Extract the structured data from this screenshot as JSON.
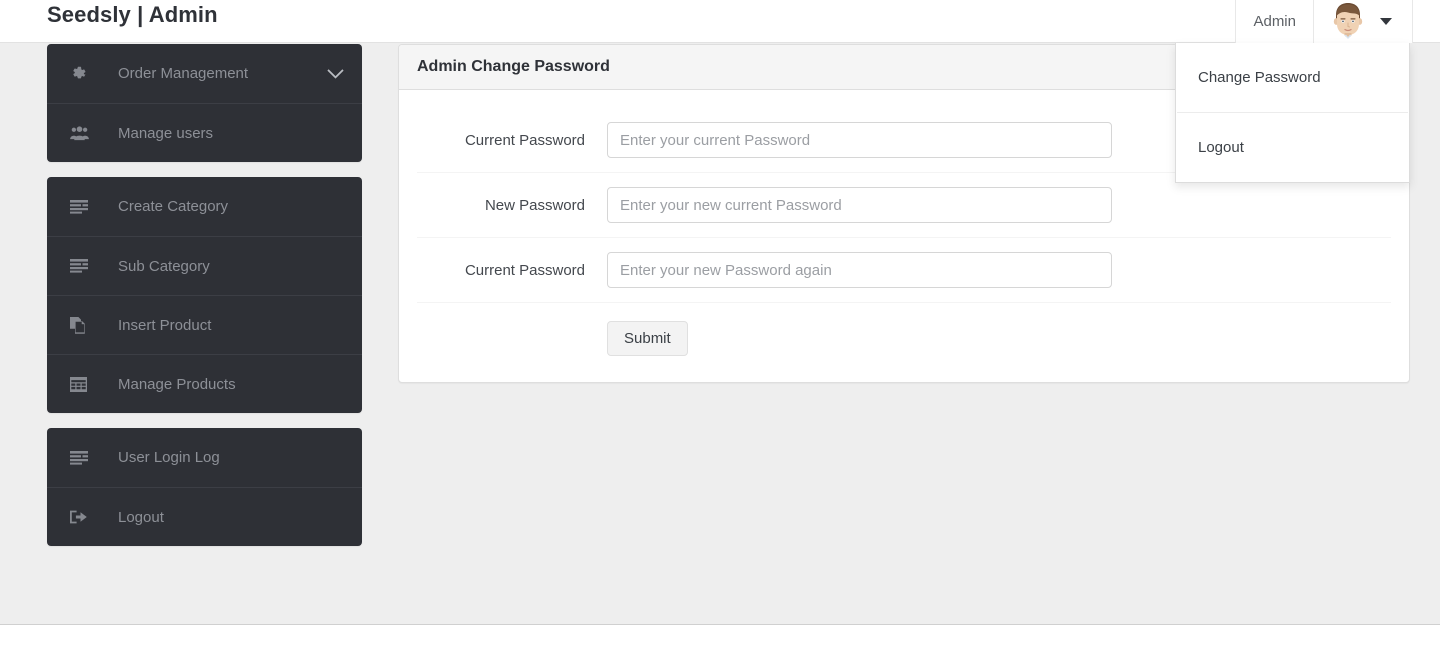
{
  "navbar": {
    "brand": "Seedsly | Admin",
    "admin_label": "Admin",
    "avatar_icon": "user-avatar-icon",
    "caret_icon": "caret-down-icon"
  },
  "user_dropdown": {
    "items": [
      {
        "label": "Change Password",
        "name": "change-password"
      },
      {
        "label": "Logout",
        "name": "logout"
      }
    ]
  },
  "sidebar": {
    "groups": [
      {
        "items": [
          {
            "label": "Order Management",
            "icon": "gear-icon",
            "chevron": "chevron-down-icon"
          },
          {
            "label": "Manage users",
            "icon": "users-icon"
          }
        ]
      },
      {
        "items": [
          {
            "label": "Create Category",
            "icon": "list-icon"
          },
          {
            "label": "Sub Category",
            "icon": "list-icon"
          },
          {
            "label": "Insert Product",
            "icon": "copy-file-icon"
          },
          {
            "label": "Manage Products",
            "icon": "table-grid-icon"
          }
        ]
      },
      {
        "items": [
          {
            "label": "User Login Log",
            "icon": "list-icon"
          },
          {
            "label": "Logout",
            "icon": "sign-out-icon"
          }
        ]
      }
    ]
  },
  "panel": {
    "title": "Admin Change Password",
    "fields": [
      {
        "label": "Current Password",
        "placeholder": "Enter your current Password",
        "value": "",
        "name": "current-password"
      },
      {
        "label": "New Password",
        "placeholder": "Enter your new current Password",
        "value": "",
        "name": "new-password"
      },
      {
        "label": "Current Password",
        "placeholder": "Enter your new Password again",
        "value": "",
        "name": "confirm-password"
      }
    ],
    "submit_label": "Submit"
  },
  "colors": {
    "sidebar_bg": "#2e3036",
    "sidebar_text": "#8d9097",
    "page_bg": "#eeeeee",
    "panel_head_bg": "#f5f5f5",
    "heading_text": "#2f3238"
  }
}
